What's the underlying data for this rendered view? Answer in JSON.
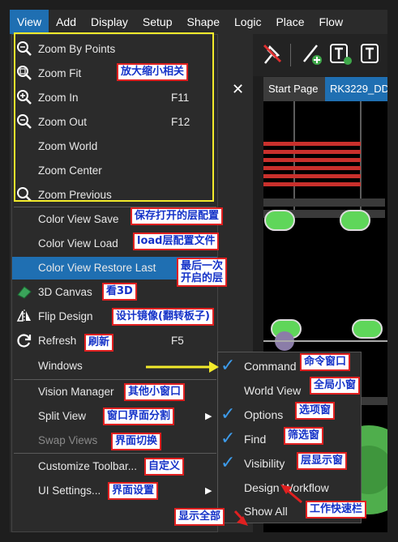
{
  "menubar": {
    "items": [
      "View",
      "Add",
      "Display",
      "Setup",
      "Shape",
      "Logic",
      "Place",
      "Flow"
    ]
  },
  "tabs": [
    "Start Page",
    "RK3229_DD"
  ],
  "view_menu": {
    "items": [
      {
        "label": "Zoom By Points",
        "shortcut": "",
        "icon": "zoom-points-icon"
      },
      {
        "label": "Zoom Fit",
        "shortcut": "",
        "icon": "zoom-fit-icon"
      },
      {
        "label": "Zoom In",
        "shortcut": "F11",
        "icon": "zoom-in-icon"
      },
      {
        "label": "Zoom Out",
        "shortcut": "F12",
        "icon": "zoom-out-icon"
      },
      {
        "label": "Zoom World",
        "shortcut": ""
      },
      {
        "label": "Zoom Center",
        "shortcut": ""
      },
      {
        "label": "Zoom Previous",
        "shortcut": "",
        "icon": "zoom-previous-icon"
      },
      {
        "label": "Color View Save",
        "shortcut": ""
      },
      {
        "label": "Color View Load",
        "shortcut": ""
      },
      {
        "label": "Color View Restore Last",
        "shortcut": ""
      },
      {
        "label": "3D Canvas",
        "shortcut": "",
        "icon": "3d-canvas-icon"
      },
      {
        "label": "Flip Design",
        "shortcut": "",
        "icon": "flip-design-icon"
      },
      {
        "label": "Refresh",
        "shortcut": "F5",
        "icon": "refresh-icon"
      },
      {
        "label": "Windows",
        "shortcut": ""
      },
      {
        "label": "Vision Manager",
        "shortcut": ""
      },
      {
        "label": "Split View",
        "shortcut": ""
      },
      {
        "label": "Swap Views",
        "shortcut": ""
      },
      {
        "label": "Customize Toolbar...",
        "shortcut": ""
      },
      {
        "label": "UI Settings...",
        "shortcut": ""
      }
    ]
  },
  "windows_submenu": {
    "items": [
      {
        "label": "Command",
        "checked": true
      },
      {
        "label": "World View",
        "checked": false
      },
      {
        "label": "Options",
        "checked": true
      },
      {
        "label": "Find",
        "checked": true
      },
      {
        "label": "Visibility",
        "checked": true
      },
      {
        "label": "Design Workflow",
        "checked": false
      },
      {
        "label": "Show All",
        "checked": false
      }
    ]
  },
  "annotations": {
    "zoom_fit": "放大缩小相关",
    "color_save": "保存打开的层配置",
    "color_load": "load层配置文件",
    "restore_last_line1": "最后一次",
    "restore_last_line2": "开启的层",
    "canvas_3d": "看3D",
    "flip": "设计镜像(翻转板子)",
    "refresh": "刷新",
    "vision": "其他小窗口",
    "split": "窗口界面分割",
    "swap": "界面切换",
    "customize": "自定义",
    "ui_settings": "界面设置",
    "command": "命令窗口",
    "world_view": "全局小窗",
    "options": "选项窗",
    "find": "筛选窗",
    "visibility": "层显示窗",
    "show_all": "显示全部",
    "workflow": "工作快速栏"
  },
  "colors": {
    "highlight": "#1f6fb2",
    "check": "#3d9bea",
    "annotation_border": "#e02020",
    "annotation_text": "#1432c8",
    "callout_box": "#f2ea2b"
  }
}
